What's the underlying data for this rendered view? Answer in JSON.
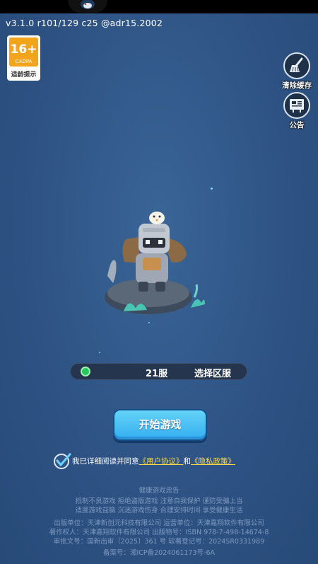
{
  "status_bar": {},
  "version_text": "v3.1.0 r101/129 c25 @adr15.2002",
  "age_rating": {
    "age": "16+",
    "org": "CADPA",
    "tip": "适龄提示"
  },
  "side_buttons": {
    "clear_cache": "清除缓存",
    "notice": "公告"
  },
  "server": {
    "name": "21服",
    "select_label": "选择区服",
    "status_color": "#26c95a"
  },
  "start_button": "开始游戏",
  "agreement": {
    "prefix": "我已详细阅读并同意",
    "user_agreement": "《用户协议》",
    "and": "和",
    "privacy_policy": "《隐私政策》"
  },
  "health_notice": {
    "title": "健康游戏忠告",
    "line1": "抵制不良游戏  拒绝盗版游戏  注意自我保护  谨防受骗上当",
    "line2": "适度游戏益脑  沉迷游戏伤身  合理安排时间  享受健康生活"
  },
  "publication": {
    "line1": "出版单位：天津新创元科技有限公司   运营单位：天津嘉翔软件有限公司",
    "line2": "著作权人：天津嘉翔软件有限公司   出版物号：ISBN 978-7-498-14674-8",
    "line3": "审批文号：国新出审〔2025〕361 号  软著登记号：2024SR0331989",
    "icp": "备案号：湘ICP备2024061173号-6A"
  },
  "colors": {
    "background": "#2f5586",
    "accent": "#3fb6f2",
    "link": "#ffd84a"
  }
}
